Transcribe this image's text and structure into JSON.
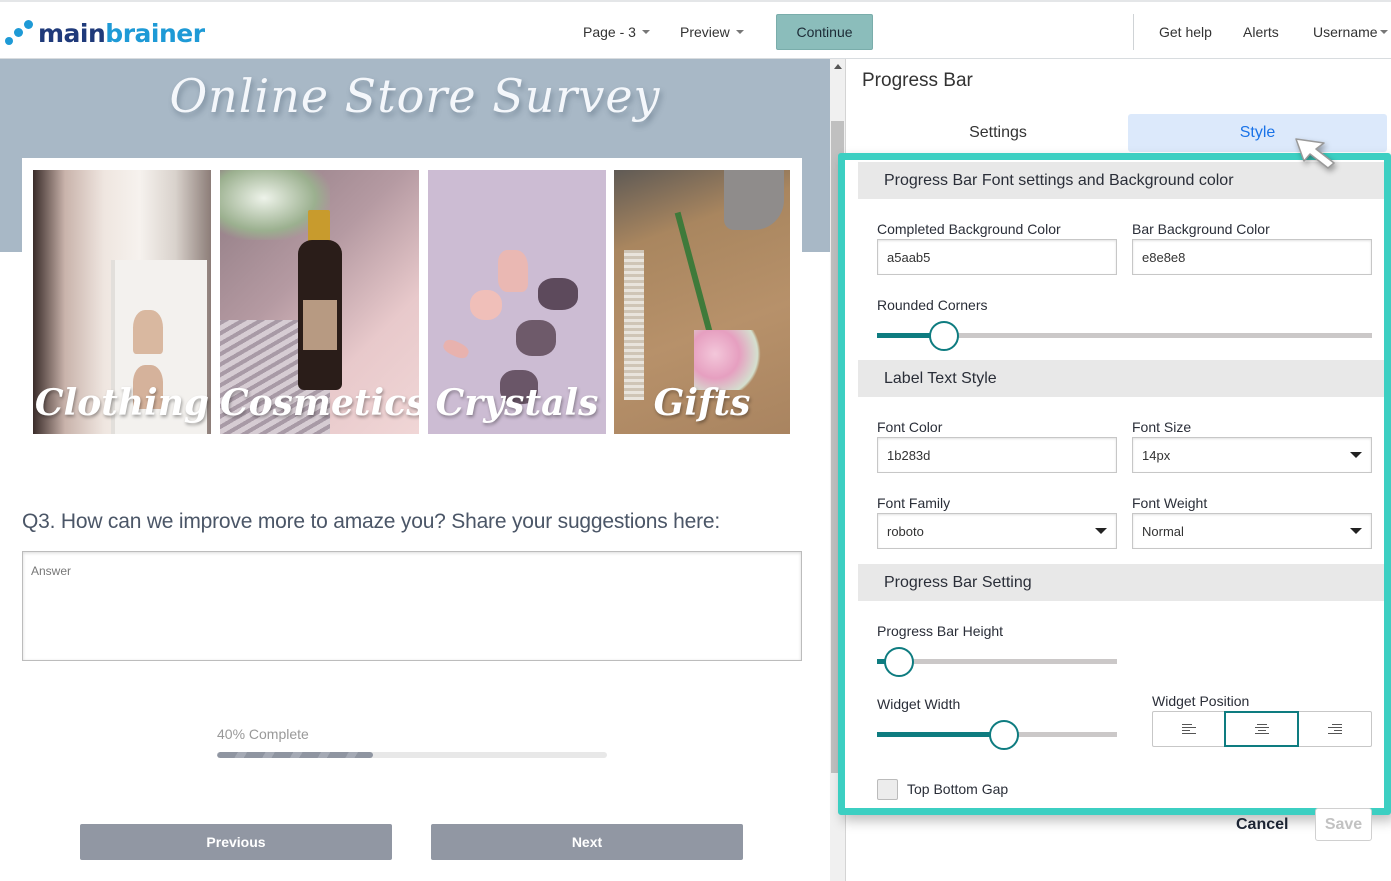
{
  "brand": {
    "part1": "main",
    "part2": "brainer",
    "colors": {
      "dark": "#1f3a7a",
      "light": "#1e9ad6"
    }
  },
  "topnav": {
    "page_label": "Page - 3",
    "preview_label": "Preview",
    "continue_label": "Continue",
    "help_label": "Get help",
    "alerts_label": "Alerts",
    "user_label": "Username"
  },
  "survey": {
    "title": "Online Store Survey",
    "banner_color": "#a8b8c6",
    "categories": [
      {
        "label": "Clothing"
      },
      {
        "label": "Cosmetics"
      },
      {
        "label": "Crystals"
      },
      {
        "label": "Gifts"
      }
    ],
    "question": "Q3. How can we improve more to amaze you? Share your suggestions here:",
    "answer_placeholder": "Answer",
    "answer_value": "",
    "progress": {
      "label": "40% Complete",
      "percent": 40,
      "completed_color": "#a5aab5",
      "bar_color": "#e8e8e8"
    },
    "previous_label": "Previous",
    "next_label": "Next"
  },
  "panel": {
    "title": "Progress Bar",
    "tabs": [
      {
        "label": "Settings",
        "active": false
      },
      {
        "label": "Style",
        "active": true
      }
    ],
    "highlight_color": "#3ccfc2",
    "sections": {
      "font_bg": {
        "heading": "Progress Bar Font settings and Background color",
        "completed_bg_label": "Completed Background Color",
        "completed_bg_value": "a5aab5",
        "bar_bg_label": "Bar Background Color",
        "bar_bg_value": "e8e8e8",
        "rounded_label": "Rounded Corners",
        "rounded_value": 0.135
      },
      "label_text": {
        "heading": "Label Text Style",
        "font_color_label": "Font Color",
        "font_color_value": "1b283d",
        "font_size_label": "Font Size",
        "font_size_value": "14px",
        "font_family_label": "Font Family",
        "font_family_value": "roboto",
        "font_weight_label": "Font Weight",
        "font_weight_value": "Normal"
      },
      "bar_setting": {
        "heading": "Progress Bar Setting",
        "height_label": "Progress Bar Height",
        "height_value": 0.09,
        "width_label": "Widget Width",
        "width_value": 0.53,
        "position_label": "Widget Position",
        "positions": [
          {
            "name": "left",
            "active": false
          },
          {
            "name": "center",
            "active": true
          },
          {
            "name": "right",
            "active": false
          }
        ],
        "gap_label": "Top Bottom Gap",
        "gap_checked": false
      }
    },
    "cancel_label": "Cancel",
    "save_label": "Save"
  }
}
